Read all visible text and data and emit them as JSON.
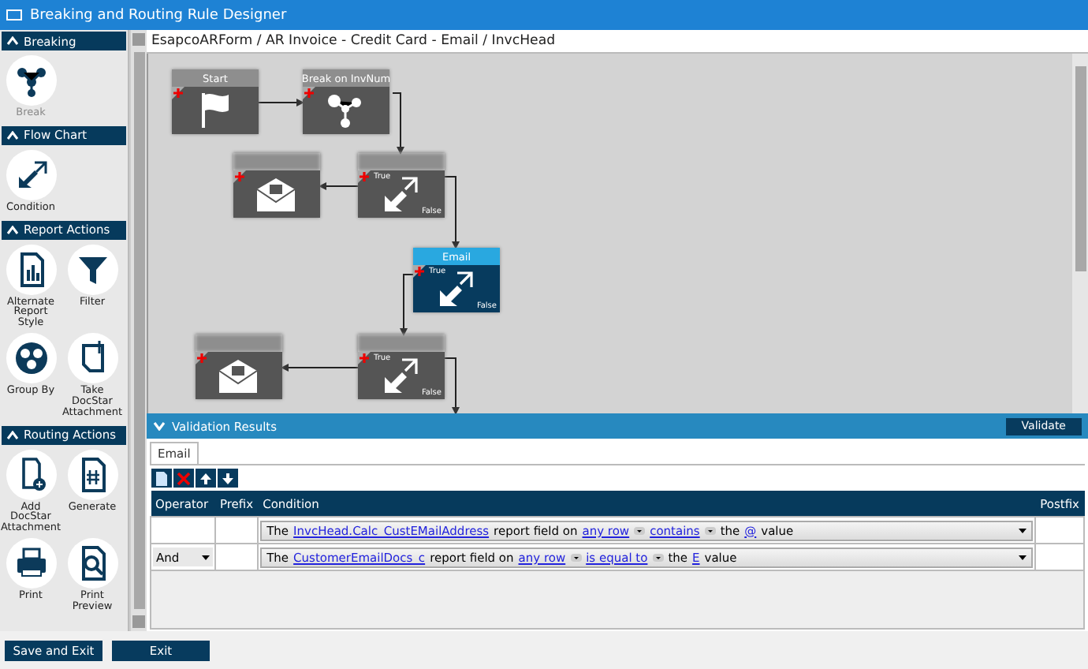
{
  "window": {
    "title": "Breaking and Routing Rule Designer"
  },
  "palette": {
    "sections": [
      {
        "title": "Breaking",
        "expanded": true,
        "items": [
          {
            "label": "Break",
            "kind": "break"
          }
        ]
      },
      {
        "title": "Flow Chart",
        "expanded": true,
        "items": [
          {
            "label": "Condition",
            "kind": "condition"
          }
        ]
      },
      {
        "title": "Report Actions",
        "expanded": true,
        "items": [
          {
            "label": "Alternate Report Style",
            "kind": "report-style"
          },
          {
            "label": "Filter",
            "kind": "filter"
          },
          {
            "label": "Group By",
            "kind": "group-by"
          },
          {
            "label": "Take DocStar Attachment",
            "kind": "attachment"
          }
        ]
      },
      {
        "title": "Routing Actions",
        "expanded": true,
        "items": [
          {
            "label": "Add DocStar Attachment",
            "kind": "add-attachment"
          },
          {
            "label": "Generate",
            "kind": "generate"
          },
          {
            "label": "Print",
            "kind": "print"
          },
          {
            "label": "Print Preview",
            "kind": "print-preview"
          }
        ]
      }
    ]
  },
  "breadcrumb": "EsapcoARForm / AR Invoice - Credit Card - Email / InvcHead",
  "canvas": {
    "nodes": [
      {
        "kind": "start",
        "title": "Start",
        "selected": false
      },
      {
        "kind": "break",
        "title": "Break on InvNum",
        "selected": false
      },
      {
        "kind": "email",
        "selected": false
      },
      {
        "kind": "condition",
        "true_label": "True",
        "false_label": "False",
        "selected": false
      },
      {
        "kind": "condition",
        "title": "Email",
        "true_label": "True",
        "false_label": "False",
        "selected": true
      },
      {
        "kind": "email",
        "selected": false
      },
      {
        "kind": "condition",
        "true_label": "True",
        "false_label": "False",
        "selected": false
      }
    ]
  },
  "validation": {
    "title": "Validation Results",
    "expanded": true,
    "button": "Validate",
    "tabs": [
      {
        "label": "Email",
        "selected": true
      }
    ],
    "columns": [
      "Operator",
      "Prefix",
      "Condition",
      "Postfix"
    ],
    "rows": [
      {
        "segments": [
          {
            "kind": "text",
            "text": "The"
          },
          {
            "kind": "link",
            "text": "InvcHead.Calc_CustEMailAddress"
          },
          {
            "kind": "text",
            "text": "report field on"
          },
          {
            "kind": "menu-link",
            "text": "any row"
          },
          {
            "kind": "menu-link",
            "text": "contains"
          },
          {
            "kind": "text",
            "text": "the"
          },
          {
            "kind": "link",
            "text": "@"
          },
          {
            "kind": "text",
            "text": "value"
          }
        ]
      },
      {
        "operator": "And",
        "segments": [
          {
            "kind": "text",
            "text": "The"
          },
          {
            "kind": "link",
            "text": "CustomerEmailDocs_c"
          },
          {
            "kind": "text",
            "text": "report field on"
          },
          {
            "kind": "menu-link",
            "text": "any row"
          },
          {
            "kind": "menu-link",
            "text": "is equal to"
          },
          {
            "kind": "text",
            "text": "the"
          },
          {
            "kind": "link",
            "text": "E"
          },
          {
            "kind": "text",
            "text": "value"
          }
        ]
      }
    ]
  },
  "footer": {
    "buttons": [
      "Save and Exit",
      "Exit"
    ]
  }
}
